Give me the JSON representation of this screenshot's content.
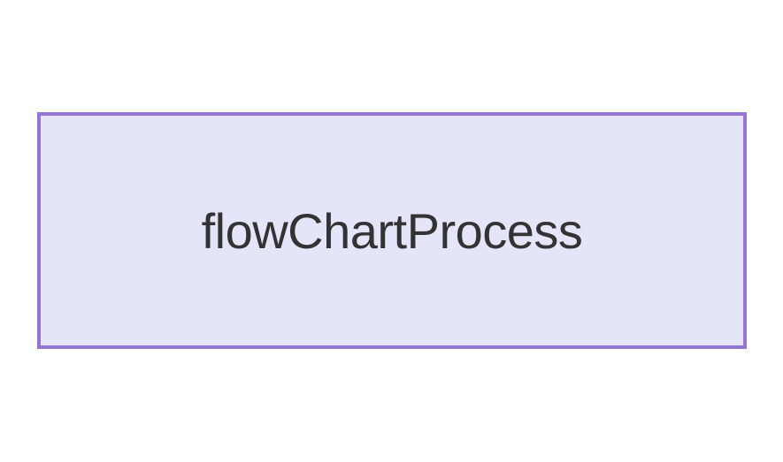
{
  "shape": {
    "label": "flowChartProcess",
    "fillColor": "#e5e5fa",
    "borderColor": "#9673d6",
    "textColor": "#333333"
  }
}
